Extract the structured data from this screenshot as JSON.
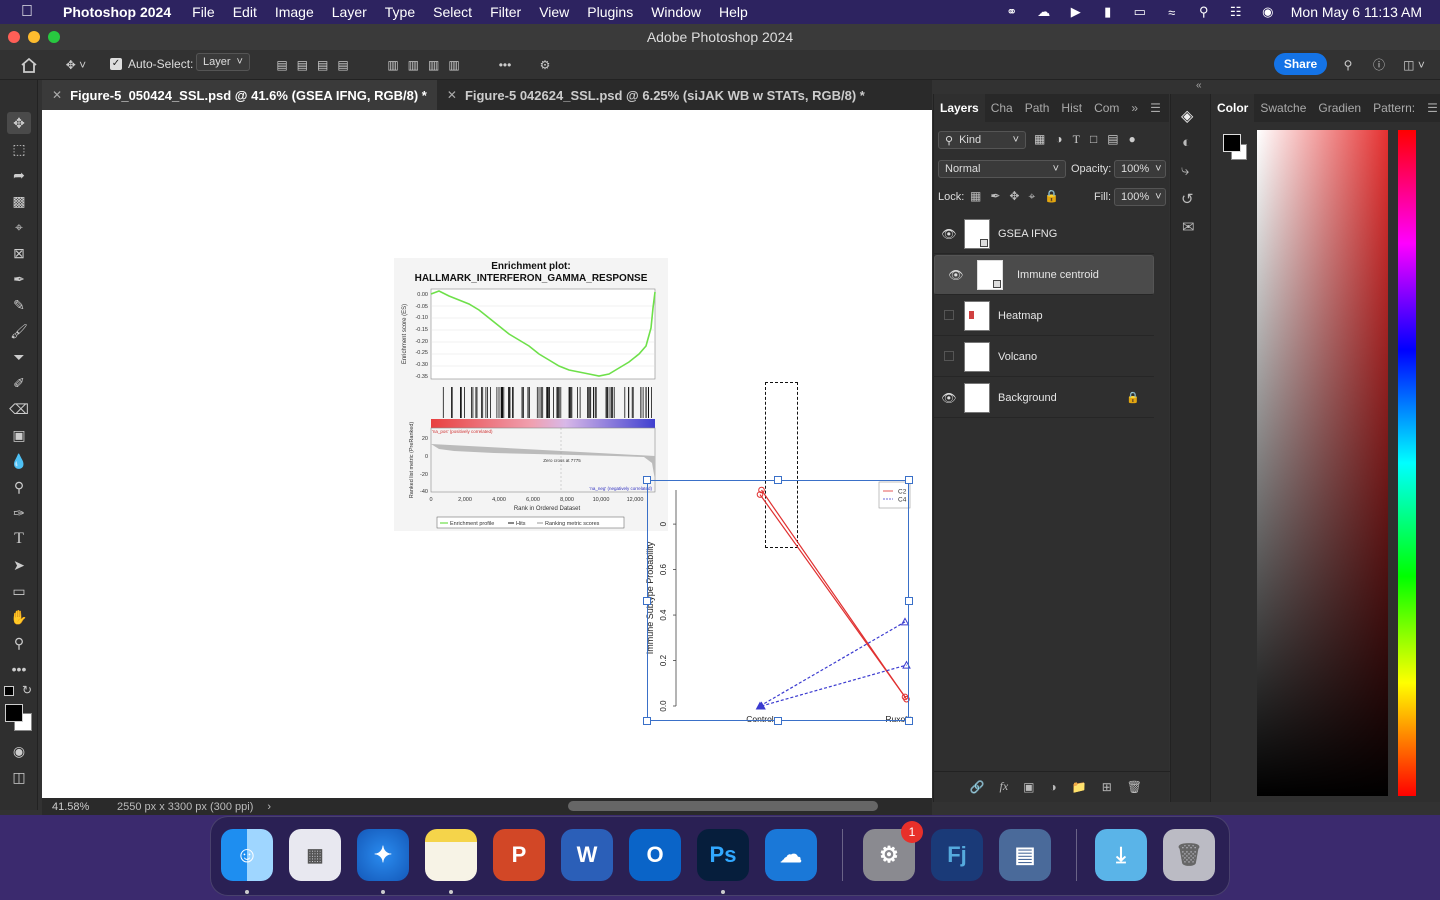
{
  "menubar": {
    "app": "Photoshop 2024",
    "items": [
      "File",
      "Edit",
      "Image",
      "Layer",
      "Type",
      "Select",
      "Filter",
      "View",
      "Plugins",
      "Window",
      "Help"
    ],
    "clock": "Mon May 6  11:13 AM"
  },
  "window": {
    "title": "Adobe Photoshop 2024"
  },
  "options": {
    "auto_select_label": "Auto-Select:",
    "auto_select_value": "Layer",
    "share_label": "Share"
  },
  "tabs": [
    {
      "label": "Figure-5_050424_SSL.psd @ 41.6% (GSEA IFNG, RGB/8) *"
    },
    {
      "label": "Figure-5 042624_SSL.psd @ 6.25% (siJAK WB w STATs, RGB/8) *"
    }
  ],
  "gsea": {
    "title1": "Enrichment plot:",
    "title2": "HALLMARK_INTERFERON_GAMMA_RESPONSE",
    "es_ylabel": "Enrichment score (ES)",
    "es_ticks": [
      "0.00",
      "-0.05",
      "-0.10",
      "-0.15",
      "-0.20",
      "-0.25",
      "-0.30",
      "-0.35"
    ],
    "rank_ylabel": "Ranked list metric (PreRanked)",
    "rank_ticks": [
      "20",
      "0",
      "-20",
      "-40"
    ],
    "pos_label": "'na_pos' (positively correlated)",
    "neg_label": "'na_neg' (negatively correlated)",
    "zero_cross": "Zero cross at 7775",
    "xticks": [
      "0",
      "2,000",
      "4,000",
      "6,000",
      "8,000",
      "10,000",
      "12,000"
    ],
    "xlabel": "Rank in Ordered Dataset",
    "legend": [
      "Enrichment profile",
      "Hits",
      "Ranking metric scores"
    ]
  },
  "chart_data": {
    "type": "line",
    "ylabel": "Immune Subtype Probability",
    "categories": [
      "Control",
      "Ruxolitinib"
    ],
    "yticks": [
      "0.0",
      "0.2",
      "0.4",
      "0.6",
      "0"
    ],
    "ylim": [
      0,
      0.85
    ],
    "series": [
      {
        "name": "C2",
        "color": "#e03030",
        "values": [
          0.93,
          0.04
        ]
      },
      {
        "name": "C2",
        "color": "#e03030",
        "values": [
          0.95,
          0.03
        ]
      },
      {
        "name": "C4",
        "color": "#3b3bd0",
        "values": [
          0.0,
          0.37
        ]
      },
      {
        "name": "C4",
        "color": "#3b3bd0",
        "values": [
          0.0,
          0.18
        ]
      }
    ],
    "legend": [
      "C2",
      "C4"
    ]
  },
  "layers_panel": {
    "tabs": [
      "Layers",
      "Cha",
      "Path",
      "Hist",
      "Com"
    ],
    "filter": "Kind",
    "blend": "Normal",
    "opacity_label": "Opacity:",
    "opacity": "100%",
    "lock_label": "Lock:",
    "fill_label": "Fill:",
    "fill": "100%",
    "layers": [
      {
        "name": "GSEA IFNG",
        "visible": true
      },
      {
        "name": "Immune centroid",
        "visible": true
      },
      {
        "name": "Heatmap",
        "visible": false
      },
      {
        "name": "Volcano",
        "visible": false
      },
      {
        "name": "Background",
        "visible": true
      }
    ]
  },
  "color_panel": {
    "tabs": [
      "Color",
      "Swatche",
      "Gradien",
      "Pattern:"
    ]
  },
  "status": {
    "zoom": "41.58%",
    "doc": "2550 px x 3300 px (300 ppi)"
  },
  "dock": {
    "badge": "1"
  }
}
